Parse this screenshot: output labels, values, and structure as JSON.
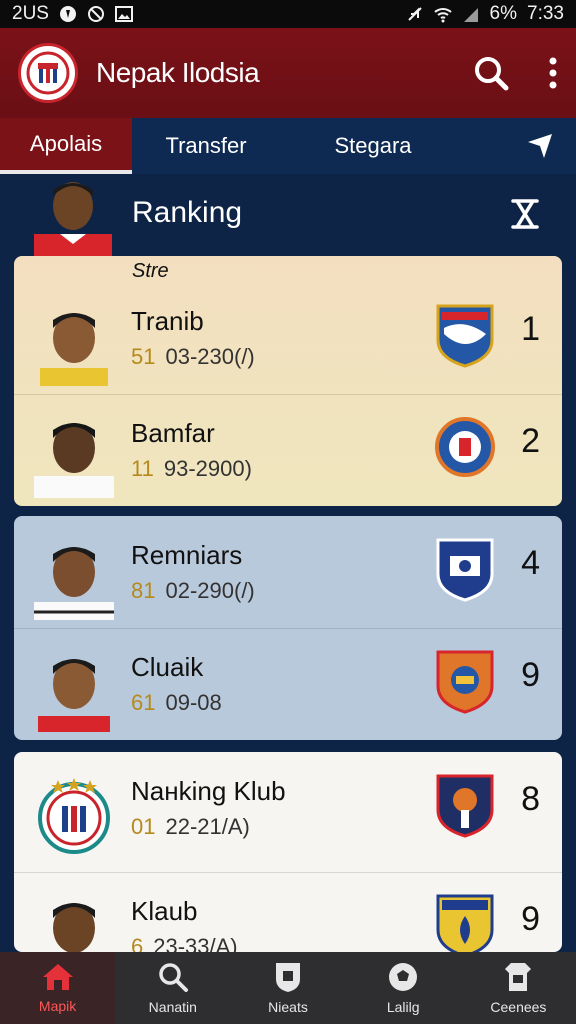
{
  "status_bar": {
    "time_left": "2US",
    "battery": "6%",
    "time": "7:33"
  },
  "app": {
    "title": "Nepak Ilodsia"
  },
  "tabs": [
    {
      "label": "Apolais",
      "active": true
    },
    {
      "label": "Transfer",
      "active": false
    },
    {
      "label": "Stegara",
      "active": false
    }
  ],
  "ranking": {
    "title": "Ranking",
    "subtitle": "Stre"
  },
  "players": [
    {
      "name": "Tranib",
      "num": "51",
      "stats": "03-230(/)",
      "rank": "1"
    },
    {
      "name": "Bamfar",
      "num": "11",
      "stats": "93-2900)",
      "rank": "2"
    },
    {
      "name": "Remniars",
      "num": "81",
      "stats": "02-290(/)",
      "rank": "4"
    },
    {
      "name": "Cluaik",
      "num": "61",
      "stats": "09-08",
      "rank": "9"
    },
    {
      "name": "Naнking Klub",
      "num": "01",
      "stats": "22-21/А)",
      "rank": "8"
    },
    {
      "name": "Klaub",
      "num": "6",
      "stats": "23-33/А)",
      "rank": "9"
    }
  ],
  "bottom_nav": [
    {
      "label": "Mapik",
      "icon": "home-icon",
      "active": true
    },
    {
      "label": "Nanatin",
      "icon": "search-icon",
      "active": false
    },
    {
      "label": "Nieats",
      "icon": "shield-icon",
      "active": false
    },
    {
      "label": "Lalilg",
      "icon": "ball-icon",
      "active": false
    },
    {
      "label": "Ceenees",
      "icon": "jersey-icon",
      "active": false
    }
  ],
  "colors": {
    "brand": "#7a1218",
    "navy": "#0e2447",
    "accent_gold": "#b58a1d"
  }
}
